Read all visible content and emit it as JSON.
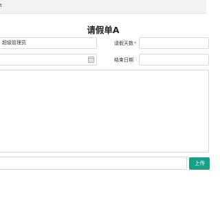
{
  "topbar": {
    "text": "t"
  },
  "form": {
    "title": "请假单A",
    "applicant_value": "超级管理员",
    "leave_days_label": "请假天数",
    "required_mark": "*",
    "leave_days_value": "",
    "start_date_value": "",
    "end_date_label": "结束日期",
    "end_date_value": "",
    "reason_value": "",
    "file_value": "",
    "upload_label": "上传"
  },
  "colors": {
    "primary_button": "#16a085",
    "required": "#e23b3b",
    "border": "#d9d9d9"
  },
  "icons": {
    "date_picker": "calendar-icon"
  }
}
